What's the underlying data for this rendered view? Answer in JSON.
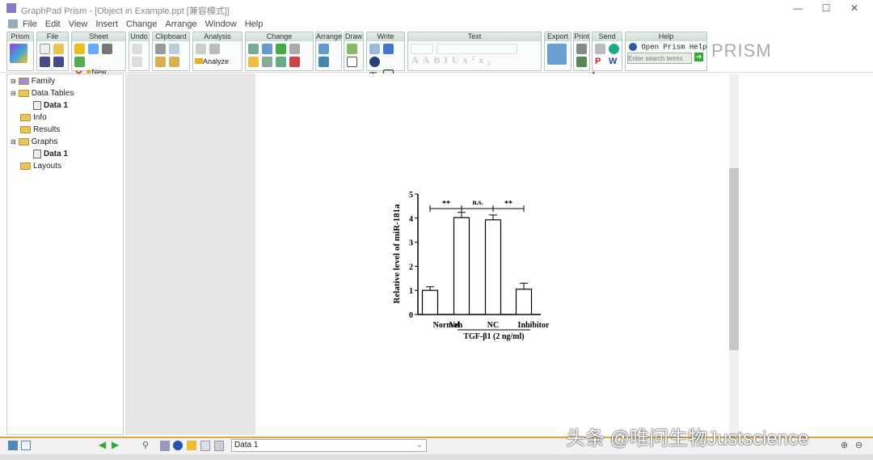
{
  "window": {
    "title": "GraphPad Prism - [Object in Example.ppt [兼容模式]]",
    "minimize": "—",
    "maximize": "☐",
    "close": "✕"
  },
  "menu": [
    "File",
    "Edit",
    "View",
    "Insert",
    "Change",
    "Arrange",
    "Window",
    "Help"
  ],
  "ribbon": {
    "groups": [
      "Prism",
      "File",
      "Sheet",
      "Undo",
      "Clipboard",
      "Analysis",
      "Change",
      "Arrange",
      "Draw",
      "Write",
      "Text",
      "Export",
      "Print",
      "Send",
      "Help"
    ],
    "new_label": "New",
    "analyze_label": "Analyze",
    "help_label": "Open Prism Help",
    "search_placeholder": "Enter search terms",
    "logo": "PRISM"
  },
  "tree": [
    {
      "label": "Family"
    },
    {
      "label": "Data Tables"
    },
    {
      "label": "Data 1"
    },
    {
      "label": "Info"
    },
    {
      "label": "Results"
    },
    {
      "label": "Graphs"
    },
    {
      "label": "Data 1"
    },
    {
      "label": "Layouts"
    }
  ],
  "status": {
    "sheet_select": "Data 1"
  },
  "watermark": "头条 @唯问生物Justscience",
  "chart_data": {
    "type": "bar",
    "categories": [
      "Normal",
      "Veh",
      "NC",
      "Inhibitor"
    ],
    "values": [
      1.0,
      4.02,
      3.93,
      1.05
    ],
    "errors": [
      0.15,
      0.22,
      0.2,
      0.25
    ],
    "ylabel": "Relative level of miR-181a",
    "ylim": [
      0,
      5
    ],
    "yticks": [
      "0",
      "1",
      "2",
      "3",
      "4",
      "5"
    ],
    "group_label": "TGF-β1 (2 ng/ml)",
    "annotations": [
      "**",
      "n.s.",
      "**"
    ]
  }
}
